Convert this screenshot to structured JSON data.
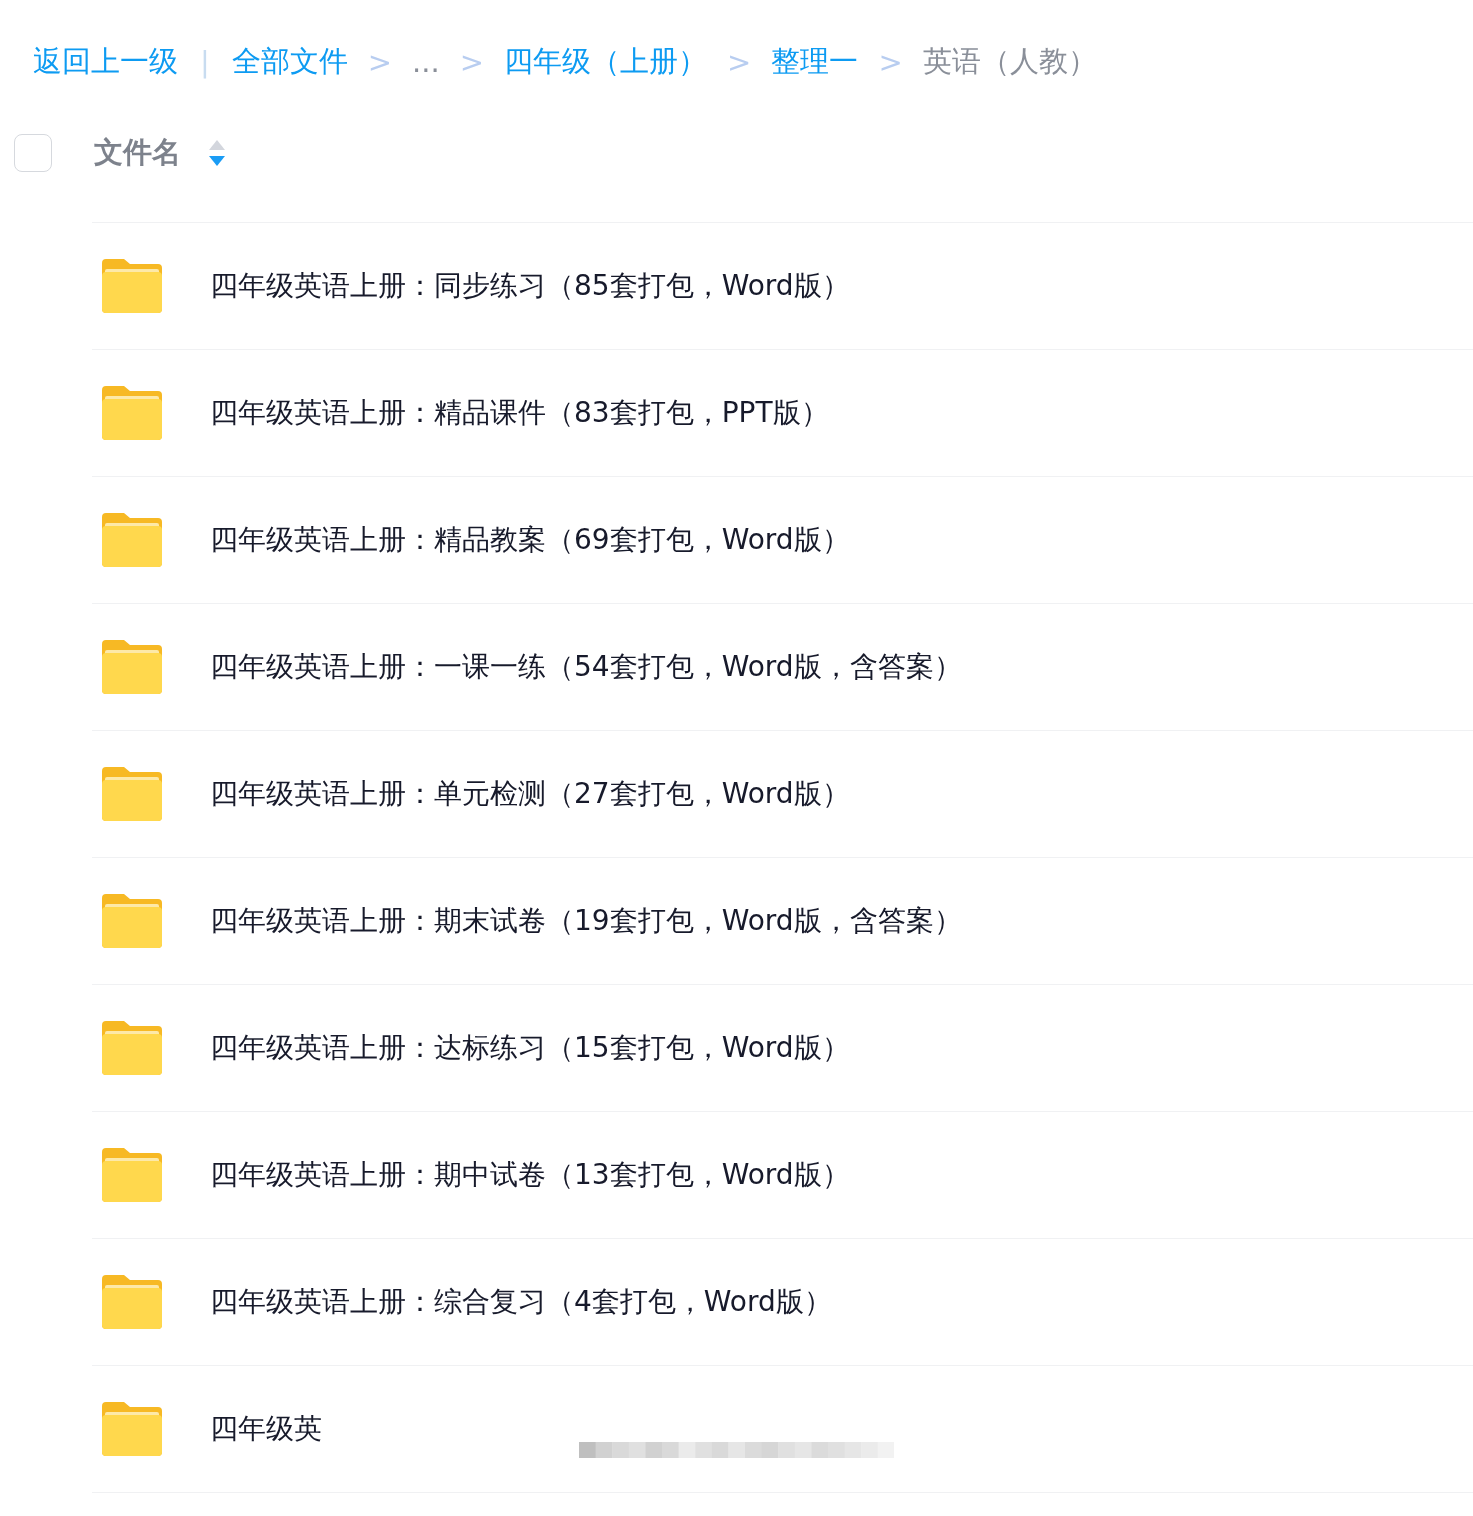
{
  "breadcrumb": {
    "back": "返回上一级",
    "divider": "|",
    "items": [
      {
        "label": "全部文件",
        "kind": "link"
      },
      {
        "label": "...",
        "kind": "ellipsis",
        "separator": ">"
      },
      {
        "label": "四年级（上册）",
        "kind": "link",
        "separator": ">"
      },
      {
        "label": "整理一",
        "kind": "link",
        "separator": ">"
      },
      {
        "label": "英语（人教）",
        "kind": "current",
        "separator": ">"
      }
    ]
  },
  "header": {
    "checked": false,
    "column": "文件名",
    "sort_descending": true
  },
  "files": [
    {
      "name": "四年级英语上册：同步练习（85套打包，Word版）"
    },
    {
      "name": "四年级英语上册：精品课件（83套打包，PPT版）"
    },
    {
      "name": "四年级英语上册：精品教案（69套打包，Word版）"
    },
    {
      "name": "四年级英语上册：一课一练（54套打包，Word版，含答案）"
    },
    {
      "name": "四年级英语上册：单元检测（27套打包，Word版）"
    },
    {
      "name": "四年级英语上册：期末试卷（19套打包，Word版，含答案）"
    },
    {
      "name": "四年级英语上册：达标练习（15套打包，Word版）"
    },
    {
      "name": "四年级英语上册：期中试卷（13套打包，Word版）"
    },
    {
      "name": "四年级英语上册：综合复习（4套打包，Word版）"
    },
    {
      "name": "四年级英",
      "redacted": true
    }
  ]
}
